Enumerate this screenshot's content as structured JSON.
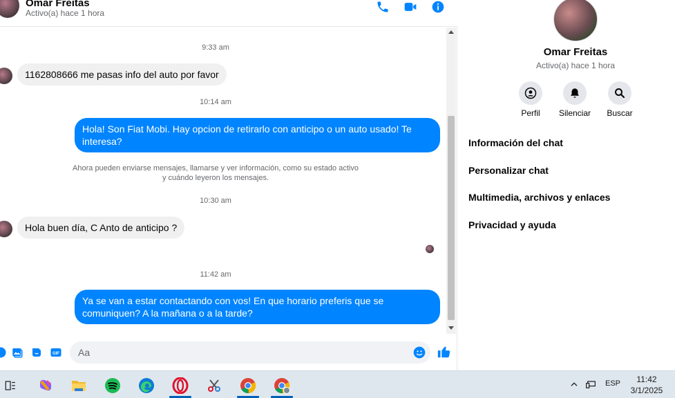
{
  "header": {
    "contact_name": "Omar Freitas",
    "status": "Activo(a) hace 1 hora"
  },
  "messages": {
    "t1": "9:33 am",
    "m1": "1162808666 me pasas info del auto por favor",
    "t2": "10:14 am",
    "m2": "Hola! Son Fiat Mobi. Hay opcion de retirarlo con anticipo o un auto usado! Te interesa?",
    "sys_line1": "Ahora pueden enviarse mensajes, llamarse y ver información, como su estado activo",
    "sys_line2": "y cuándo leyeron los mensajes.",
    "t3": "10:30 am",
    "m3": "Hola buen día, C Anto de anticipo ?",
    "t4": "11:42 am",
    "m4": "Ya se van a estar contactando con vos! En que horario preferis que se comuniquen? A la mañana o a la tarde?"
  },
  "composer": {
    "placeholder": "Aa"
  },
  "info_panel": {
    "name": "Omar Freitas",
    "status": "Activo(a) hace 1 hora",
    "actions": [
      {
        "label": "Perfil",
        "icon": "profile-icon"
      },
      {
        "label": "Silenciar",
        "icon": "bell-icon"
      },
      {
        "label": "Buscar",
        "icon": "search-icon"
      }
    ],
    "menu": [
      "Información del chat",
      "Personalizar chat",
      "Multimedia, archivos y enlaces",
      "Privacidad y ayuda"
    ]
  },
  "taskbar": {
    "language": "ESP",
    "time": "11:42",
    "date": "3/1/2025"
  },
  "colors": {
    "accent": "#0084ff",
    "bubble_in": "#f0f0f0",
    "taskbar": "#dfe7ee"
  }
}
